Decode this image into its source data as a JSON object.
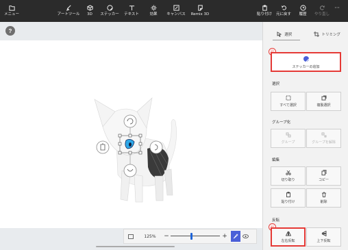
{
  "toolbar": {
    "menu": "メニュー",
    "brushes": "アートツール",
    "threed": "3D",
    "stickers": "ステッカー",
    "text": "テキスト",
    "effects": "効果",
    "canvas": "キャンバス",
    "remix": "Remix 3D",
    "paste": "貼り付け",
    "undo": "元に戻す",
    "history": "履歴",
    "redo": "やり直し",
    "more": "···"
  },
  "canvas": {
    "help": "?"
  },
  "zoom": {
    "value": "125%"
  },
  "panel": {
    "tab_select": "選択",
    "tab_trim": "トリミング",
    "sticker_badge": "⑫",
    "sticker_button": "ステッカーの追加",
    "select_heading": "選択",
    "select_all": "すべて選択",
    "duplicate": "複製選択",
    "group_heading": "グループ化",
    "group": "グループ",
    "ungroup": "グループを解除",
    "edit_heading": "編集",
    "cut": "切り取り",
    "copy": "コピー",
    "paste": "貼り付け",
    "delete": "削除",
    "flip_heading": "反転",
    "flip_badge": "⑪",
    "flip_horizontal": "左右反転",
    "flip_vertical": "上下反転"
  },
  "colors": {
    "accent": "#4a5fd8",
    "highlight": "#e53935",
    "toolbar_bg": "#2b2b2b"
  }
}
